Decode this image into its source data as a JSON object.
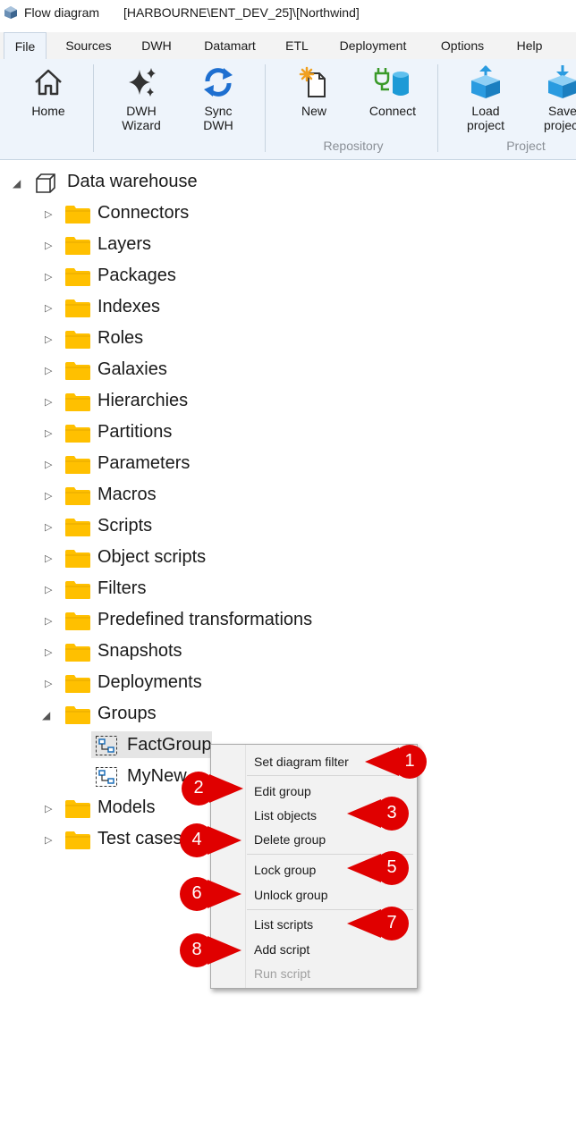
{
  "window": {
    "title": "Flow diagram",
    "connection": "[HARBOURNE\\ENT_DEV_25]\\[Northwind]"
  },
  "tabs": [
    {
      "label": "File",
      "active": true
    },
    {
      "label": "Sources"
    },
    {
      "label": "DWH"
    },
    {
      "label": "Datamart"
    },
    {
      "label": "ETL"
    },
    {
      "label": "Deployment"
    },
    {
      "label": "Options"
    },
    {
      "label": "Help"
    }
  ],
  "ribbon": {
    "home": "Home",
    "dwh_wizard": "DWH\nWizard",
    "sync_dwh": "Sync\nDWH",
    "new": "New",
    "connect": "Connect",
    "load_project": "Load\nproject",
    "save_project": "Save\nproject",
    "groups": {
      "repository": "Repository",
      "project": "Project"
    },
    "colors": {
      "sync": "#1e6fd0",
      "connect_plug": "#3a9a2a",
      "connect_db": "#1d9ad6",
      "cube": "#2a9be0",
      "new_star": "#f0a020"
    }
  },
  "tree": {
    "root": "Data warehouse",
    "folders": [
      "Connectors",
      "Layers",
      "Packages",
      "Indexes",
      "Roles",
      "Galaxies",
      "Hierarchies",
      "Partitions",
      "Parameters",
      "Macros",
      "Scripts",
      "Object scripts",
      "Filters",
      "Predefined transformations",
      "Snapshots",
      "Deployments"
    ],
    "groups_folder": "Groups",
    "group_items": [
      "FactGroup",
      "MyNew"
    ],
    "after_folders": [
      "Models",
      "Test cases"
    ],
    "folder_color": "#ffc000"
  },
  "context_menu": {
    "items": [
      {
        "label": "Set diagram filter"
      },
      {
        "label": "Edit group"
      },
      {
        "label": "List objects"
      },
      {
        "label": "Delete group"
      },
      {
        "label": "Lock group"
      },
      {
        "label": "Unlock group"
      },
      {
        "label": "List scripts"
      },
      {
        "label": "Add script"
      },
      {
        "label": "Run script",
        "disabled": true
      }
    ]
  },
  "callouts": {
    "color": "#e00000",
    "numbers": [
      "1",
      "2",
      "3",
      "4",
      "5",
      "6",
      "7",
      "8"
    ]
  }
}
